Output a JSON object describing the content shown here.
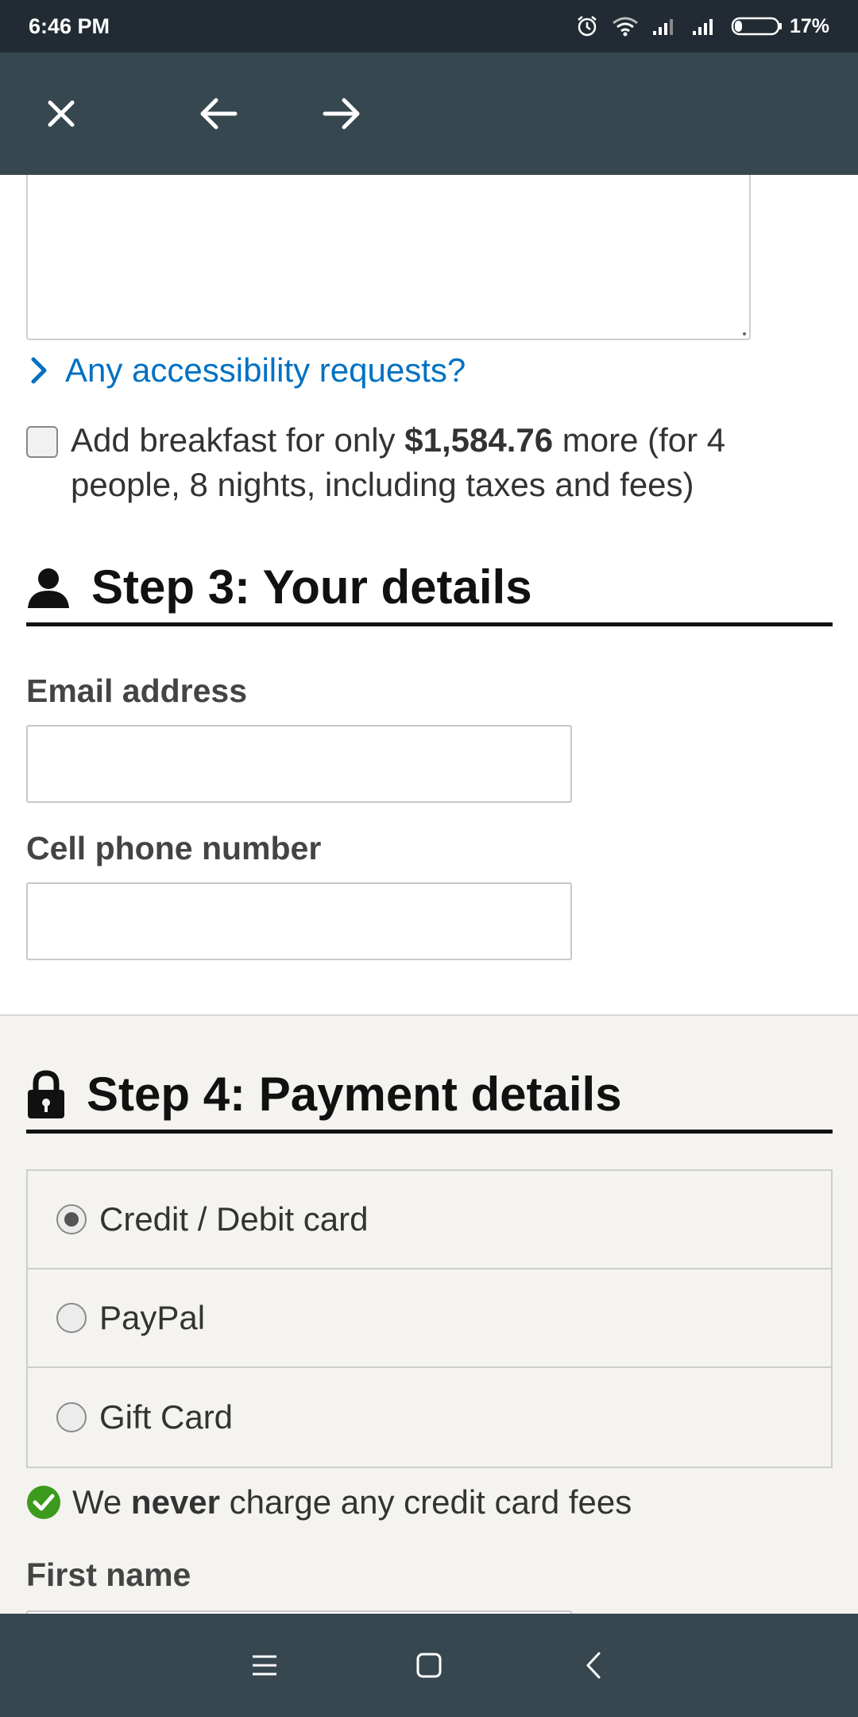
{
  "status_bar": {
    "time": "6:46 PM",
    "battery": "17%",
    "icons": [
      "alarm-icon",
      "wifi-icon",
      "signal-icon",
      "signal-icon",
      "battery-icon"
    ]
  },
  "toolbar": {
    "icons": [
      "close-icon",
      "arrow-left-icon",
      "arrow-right-icon"
    ]
  },
  "booking": {
    "accessibility_link": "Any accessibility requests?",
    "breakfast": {
      "prefix": "Add breakfast for only ",
      "price": "$1,584.76",
      "suffix": " more (for 4 people, 8 nights, including taxes and fees)"
    }
  },
  "step3": {
    "title": "Step 3: Your details",
    "email_label": "Email address",
    "phone_label": "Cell phone number"
  },
  "step4": {
    "title": "Step 4: Payment details",
    "options": [
      {
        "label": "Credit / Debit card",
        "selected": true
      },
      {
        "label": "PayPal",
        "selected": false
      },
      {
        "label": "Gift Card",
        "selected": false
      }
    ],
    "fees_note": {
      "prefix": "We ",
      "bold": "never",
      "suffix": " charge any credit card fees"
    },
    "first_name_label": "First name"
  },
  "nav_bar": {
    "icons": [
      "menu-icon",
      "home-icon",
      "back-icon"
    ]
  },
  "colors": {
    "status_bar": "#222b33",
    "toolbar": "#37474f",
    "link": "#0071c2",
    "check_green": "#3c9a1c"
  }
}
